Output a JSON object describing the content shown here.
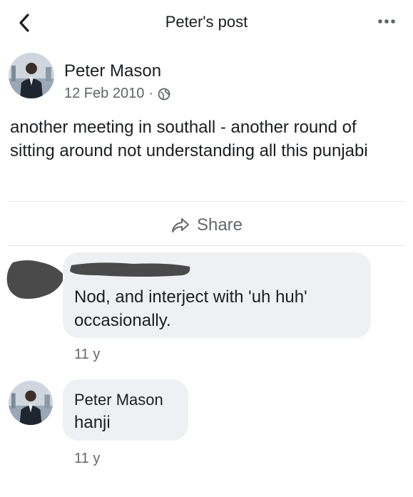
{
  "header": {
    "title": "Peter's post",
    "back_icon": "chevron-left-icon",
    "more_icon": "more-dots-icon"
  },
  "post": {
    "author": "Peter Mason",
    "date": "12 Feb 2010",
    "separator": "·",
    "privacy_icon": "globe-icon",
    "text": "another meeting in southall - another round of sitting around not understanding all this punjabi"
  },
  "actions": {
    "share_label": "Share",
    "share_icon": "share-arrow-icon"
  },
  "comments": [
    {
      "author": "",
      "author_redacted": true,
      "text": "Nod, and interject with 'uh huh' occasionally.",
      "time": "11 y"
    },
    {
      "author": "Peter Mason",
      "text": "hanji",
      "time": "11 y"
    }
  ],
  "colors": {
    "bubble": "#eef0f3",
    "divider": "#e4e6eb",
    "secondary_text": "#65676b",
    "redaction": "#4a4a4a"
  }
}
